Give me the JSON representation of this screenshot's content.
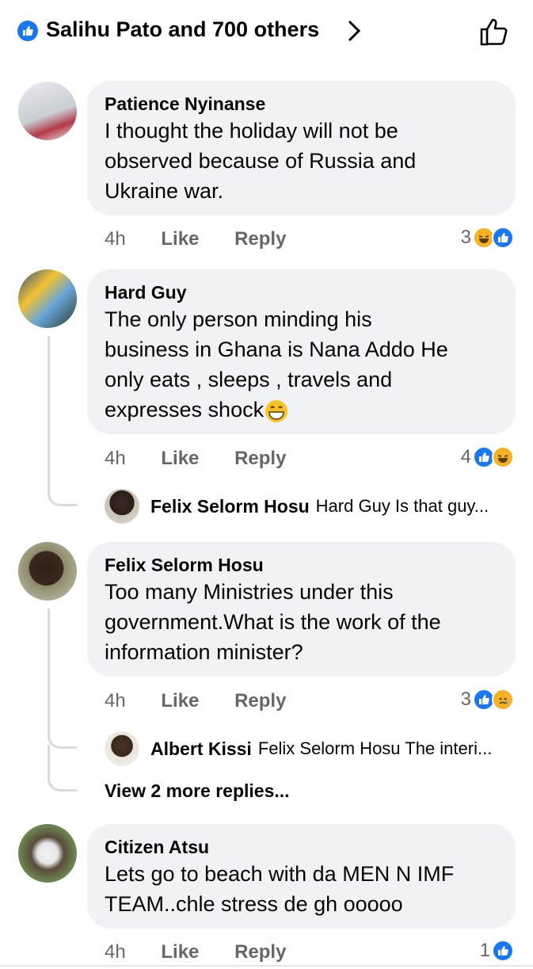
{
  "header": {
    "reactions_text": "Salihu Pato and 700 others"
  },
  "comments": [
    {
      "author": "Patience Nyinanse",
      "text": "I thought  the holiday will not be\nobserved because of Russia and\nUkraine war.",
      "time": "4h",
      "like_label": "Like",
      "reply_label": "Reply",
      "reaction_count": "3",
      "reaction_icons": [
        "haha-icon",
        "like-icon"
      ]
    },
    {
      "author": "Hard Guy",
      "text": "The only person minding his\nbusiness in Ghana is Nana  Addo He\nonly eats , sleeps , travels and\nexpresses shock",
      "time": "4h",
      "like_label": "Like",
      "reply_label": "Reply",
      "reaction_count": "4",
      "reaction_icons": [
        "like-icon",
        "haha-icon"
      ],
      "reply_preview": {
        "author": "Felix Selorm Hosu",
        "text": "Hard Guy Is that guy..."
      }
    },
    {
      "author": "Felix Selorm Hosu",
      "text": "Too many Ministries under this\ngovernment.What is the work of the\ninformation minister?",
      "time": "4h",
      "like_label": "Like",
      "reply_label": "Reply",
      "reaction_count": "3",
      "reaction_icons": [
        "like-icon",
        "sad-icon"
      ],
      "reply_preview": {
        "author": "Albert Kissi",
        "text": "Felix Selorm Hosu The interi..."
      },
      "more_replies": "View 2 more replies..."
    },
    {
      "author": "Citizen Atsu",
      "text": "Lets go to beach with da MEN N IMF\nTEAM..chle stress de gh ooooo",
      "time": "4h",
      "like_label": "Like",
      "reply_label": "Reply",
      "reaction_count": "1",
      "reaction_icons": [
        "like-icon"
      ]
    }
  ],
  "colors": {
    "brand_blue": "#1877f2",
    "bubble": "#f0f2f5",
    "muted": "#65676b"
  }
}
